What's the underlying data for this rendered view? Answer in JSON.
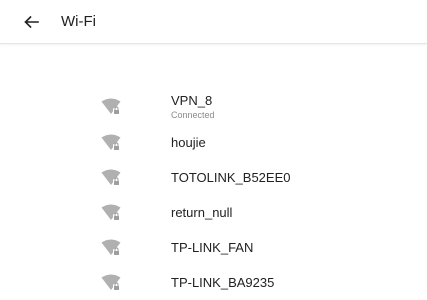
{
  "header": {
    "back_icon": "arrow-left-icon",
    "title": "Wi-Fi"
  },
  "networks": [
    {
      "ssid": "VPN_8",
      "status": "Connected",
      "icon": "wifi-locked-icon"
    },
    {
      "ssid": "houjie",
      "status": "",
      "icon": "wifi-locked-icon"
    },
    {
      "ssid": "TOTOLINK_B52EE0",
      "status": "",
      "icon": "wifi-locked-icon"
    },
    {
      "ssid": "return_null",
      "status": "",
      "icon": "wifi-locked-icon"
    },
    {
      "ssid": "TP-LINK_FAN",
      "status": "",
      "icon": "wifi-locked-icon"
    },
    {
      "ssid": "TP-LINK_BA9235",
      "status": "",
      "icon": "wifi-locked-icon"
    }
  ],
  "colors": {
    "icon": "#b0b0b0",
    "text_primary": "#212121",
    "text_secondary": "#8a8a8a",
    "divider": "#e6e6e6"
  }
}
